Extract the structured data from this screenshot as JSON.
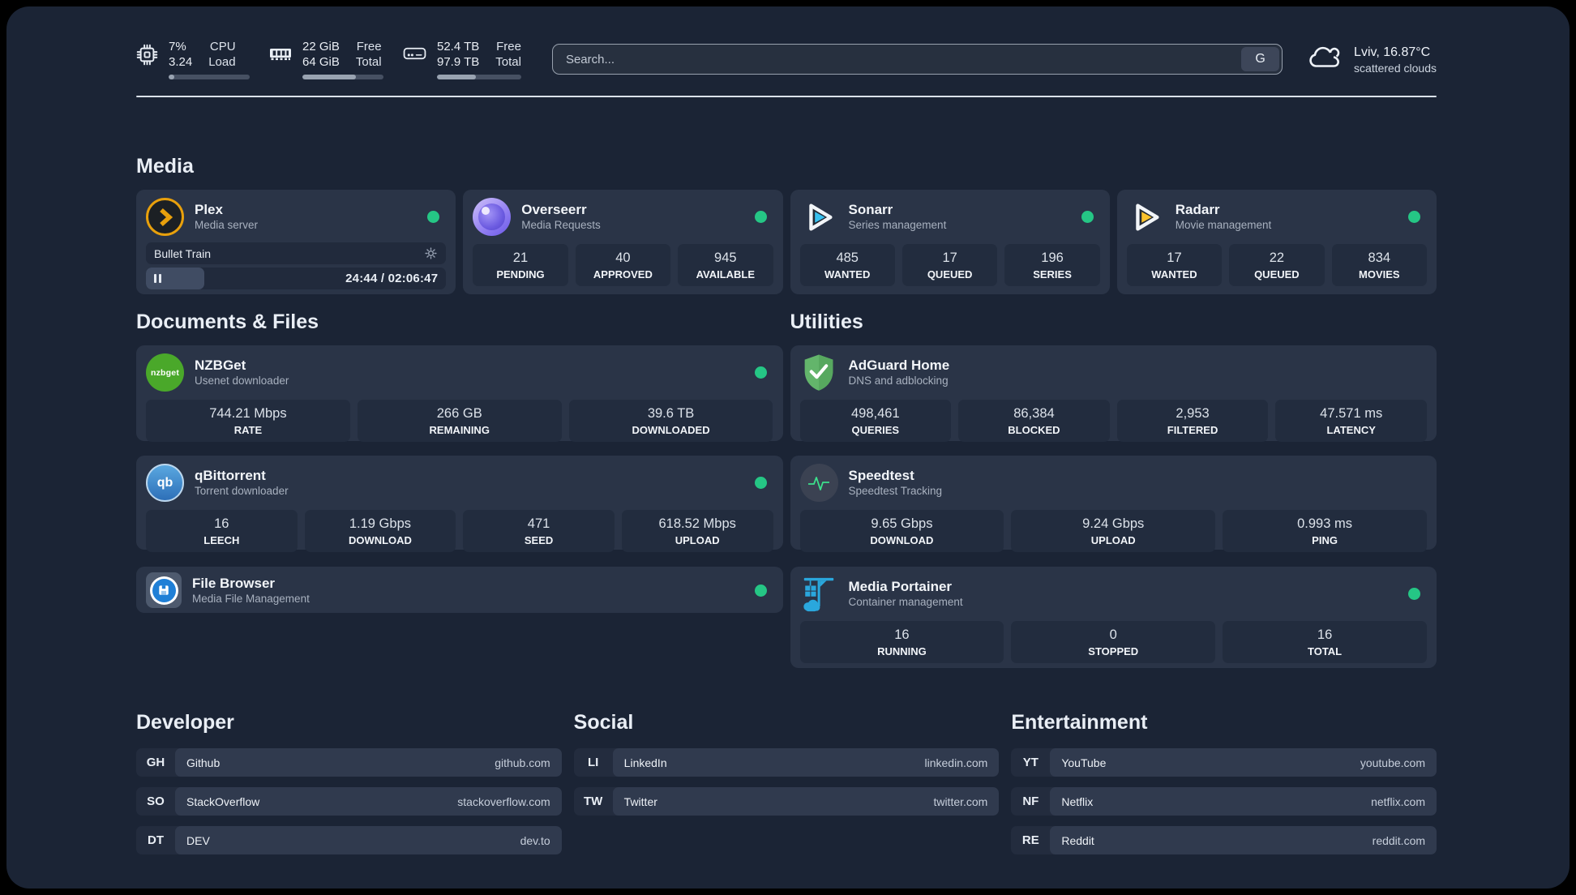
{
  "topbar": {
    "stats": [
      {
        "icon": "cpu-chip",
        "value_top": "7%",
        "value_bottom": "3.24",
        "label_top": "CPU",
        "label_bottom": "Load",
        "progress": 7
      },
      {
        "icon": "ram",
        "value_top": "22 GiB",
        "value_bottom": "64 GiB",
        "label_top": "Free",
        "label_bottom": "Total",
        "progress": 66
      },
      {
        "icon": "hard-disk",
        "value_top": "52.4 TB",
        "value_bottom": "97.9 TB",
        "label_top": "Free",
        "label_bottom": "Total",
        "progress": 46
      }
    ],
    "search": {
      "placeholder": "Search...",
      "button_label": "G"
    },
    "weather": {
      "summary": "Lviv, 16.87°C",
      "condition": "scattered clouds"
    }
  },
  "sections": {
    "media": {
      "title": "Media",
      "plex": {
        "name": "Plex",
        "subtitle": "Media server",
        "online": true,
        "player": {
          "track": "Bullet Train",
          "time_display": "24:44 / 02:06:47",
          "progress_pct": 19.5
        }
      },
      "overseerr": {
        "name": "Overseerr",
        "subtitle": "Media Requests",
        "online": true,
        "stats": [
          {
            "value": "21",
            "label": "PENDING"
          },
          {
            "value": "40",
            "label": "APPROVED"
          },
          {
            "value": "945",
            "label": "AVAILABLE"
          }
        ]
      },
      "sonarr": {
        "name": "Sonarr",
        "subtitle": "Series management",
        "online": true,
        "stats": [
          {
            "value": "485",
            "label": "WANTED"
          },
          {
            "value": "17",
            "label": "QUEUED"
          },
          {
            "value": "196",
            "label": "SERIES"
          }
        ]
      },
      "radarr": {
        "name": "Radarr",
        "subtitle": "Movie management",
        "online": true,
        "stats": [
          {
            "value": "17",
            "label": "WANTED"
          },
          {
            "value": "22",
            "label": "QUEUED"
          },
          {
            "value": "834",
            "label": "MOVIES"
          }
        ]
      }
    },
    "documents": {
      "title": "Documents & Files",
      "nzbget": {
        "name": "NZBGet",
        "subtitle": "Usenet downloader",
        "online": true,
        "stats": [
          {
            "value": "744.21 Mbps",
            "label": "RATE"
          },
          {
            "value": "266 GB",
            "label": "REMAINING"
          },
          {
            "value": "39.6 TB",
            "label": "DOWNLOADED"
          }
        ]
      },
      "qbittorrent": {
        "name": "qBittorrent",
        "subtitle": "Torrent downloader",
        "online": true,
        "stats": [
          {
            "value": "16",
            "label": "LEECH"
          },
          {
            "value": "1.19 Gbps",
            "label": "DOWNLOAD"
          },
          {
            "value": "471",
            "label": "SEED"
          },
          {
            "value": "618.52 Mbps",
            "label": "UPLOAD"
          }
        ]
      },
      "filebrowser": {
        "name": "File Browser",
        "subtitle": "Media File Management",
        "online": true
      }
    },
    "utilities": {
      "title": "Utilities",
      "adguard": {
        "name": "AdGuard Home",
        "subtitle": "DNS and adblocking",
        "stats": [
          {
            "value": "498,461",
            "label": "QUERIES"
          },
          {
            "value": "86,384",
            "label": "BLOCKED"
          },
          {
            "value": "2,953",
            "label": "FILTERED"
          },
          {
            "value": "47.571 ms",
            "label": "LATENCY"
          }
        ]
      },
      "speedtest": {
        "name": "Speedtest",
        "subtitle": "Speedtest Tracking",
        "stats": [
          {
            "value": "9.65 Gbps",
            "label": "DOWNLOAD"
          },
          {
            "value": "9.24 Gbps",
            "label": "UPLOAD"
          },
          {
            "value": "0.993 ms",
            "label": "PING"
          }
        ]
      },
      "portainer": {
        "name": "Media Portainer",
        "subtitle": "Container management",
        "online": true,
        "stats": [
          {
            "value": "16",
            "label": "RUNNING"
          },
          {
            "value": "0",
            "label": "STOPPED"
          },
          {
            "value": "16",
            "label": "TOTAL"
          }
        ]
      }
    },
    "developer": {
      "title": "Developer",
      "links": [
        {
          "tag": "GH",
          "name": "Github",
          "url": "github.com"
        },
        {
          "tag": "SO",
          "name": "StackOverflow",
          "url": "stackoverflow.com"
        },
        {
          "tag": "DT",
          "name": "DEV",
          "url": "dev.to"
        }
      ]
    },
    "social": {
      "title": "Social",
      "links": [
        {
          "tag": "LI",
          "name": "LinkedIn",
          "url": "linkedin.com"
        },
        {
          "tag": "TW",
          "name": "Twitter",
          "url": "twitter.com"
        }
      ]
    },
    "entertainment": {
      "title": "Entertainment",
      "links": [
        {
          "tag": "YT",
          "name": "YouTube",
          "url": "youtube.com"
        },
        {
          "tag": "NF",
          "name": "Netflix",
          "url": "netflix.com"
        },
        {
          "tag": "RE",
          "name": "Reddit",
          "url": "reddit.com"
        }
      ]
    }
  },
  "icons": {
    "nzbget_label": "nzbget",
    "qb_label": "qb"
  },
  "colors": {
    "status_online": "#25c685",
    "plex_gold": "#e8a00c",
    "sonarr_blue": "#38c1ef",
    "radarr_yellow": "#fbc22c",
    "adguard_green": "#63b56b",
    "portainer_blue": "#2aa7dd",
    "speedtest_pulse": "#3ce08c",
    "page_bg": "#1b2435",
    "card_bg": "#2a3447",
    "statbox_bg": "#222c3e"
  }
}
